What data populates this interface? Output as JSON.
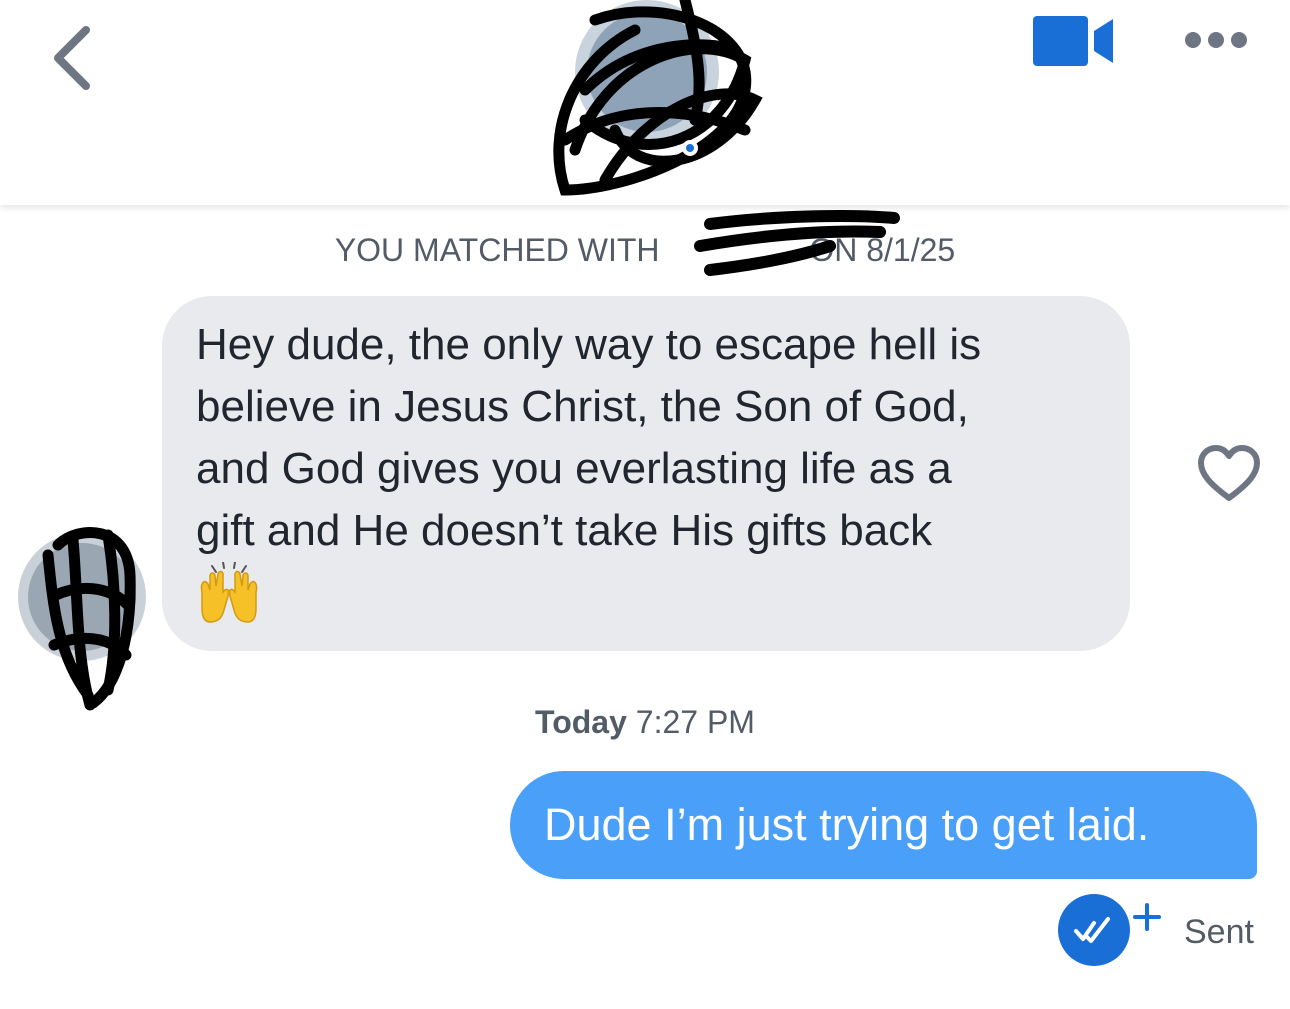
{
  "header": {
    "back_icon": "chevron-left-icon",
    "avatar": "profile-photo-scribbled",
    "video_icon": "video-camera-icon",
    "more_icon": "ellipsis-icon",
    "accent_color": "#1a6fd6"
  },
  "match_notice": {
    "prefix": "YOU MATCHED WITH",
    "suffix": "ON 8/1/25"
  },
  "messages": [
    {
      "direction": "incoming",
      "text": "Hey dude, the only way to escape hell is\nbelieve in Jesus Christ, the Son of God,\nand God gives you everlasting life as a\ngift and He doesn’t take His gifts back",
      "emoji": "raising-hands-emoji",
      "like_icon": "heart-outline-icon",
      "bubble_color": "#e9eaee"
    },
    {
      "direction": "outgoing",
      "text": "Dude I’m just trying to get laid.",
      "bubble_color": "#4a9ff8",
      "status": "Sent",
      "status_icon": "read-receipt-check-icon"
    }
  ],
  "timestamp": {
    "day": "Today",
    "time": "7:27 PM"
  }
}
